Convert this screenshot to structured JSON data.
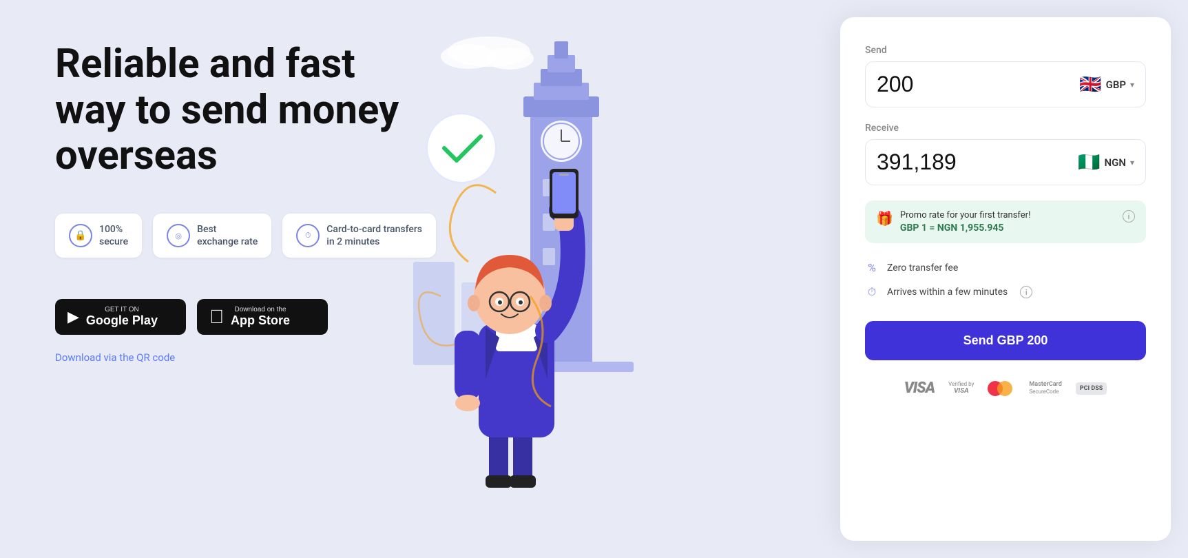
{
  "page": {
    "background_color": "#e8eaf6"
  },
  "hero": {
    "headline": "Reliable and fast way to send money overseas",
    "features": [
      {
        "id": "secure",
        "label": "100%\nsecure",
        "icon": "🔒"
      },
      {
        "id": "rate",
        "label": "Best\nexchange rate",
        "icon": "◎"
      },
      {
        "id": "speed",
        "label": "Card-to-card transfers\nin 2 minutes",
        "icon": "⏱"
      }
    ],
    "google_play": {
      "top_text": "GET IT ON",
      "main_text": "Google Play"
    },
    "app_store": {
      "top_text": "Download on the",
      "main_text": "App Store"
    },
    "qr_link": "Download via the QR code"
  },
  "transfer_widget": {
    "send_label": "Send",
    "send_amount": "200",
    "send_currency_code": "GBP",
    "send_currency_flag": "🇬🇧",
    "receive_label": "Receive",
    "receive_amount": "391,189",
    "receive_currency_code": "NGN",
    "receive_currency_flag": "🇳🇬",
    "promo": {
      "emoji": "🎁",
      "title": "Promo rate for your first transfer!",
      "rate": "GBP 1 = NGN 1,955.945"
    },
    "zero_fee": "Zero transfer fee",
    "arrives": "Arrives within a few minutes",
    "send_button": "Send GBP 200",
    "payment_logos": [
      "VISA",
      "Verified by VISA",
      "Mastercard",
      "MasterCard SecureCode",
      "PCI DSS"
    ]
  }
}
